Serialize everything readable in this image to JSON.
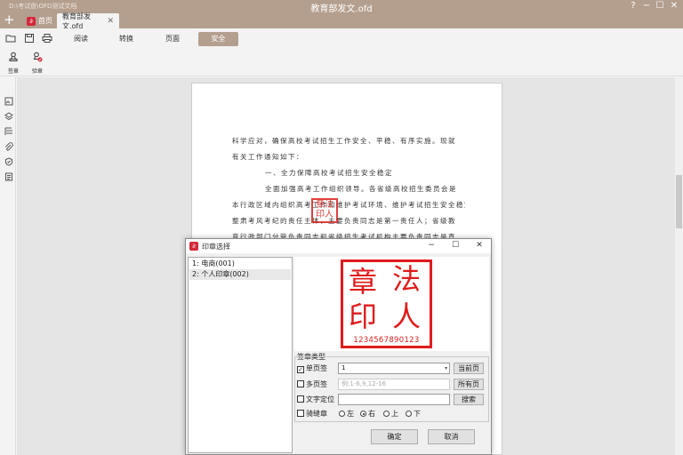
{
  "titlebar": {
    "path": "D:\\考试盘\\OFD测试文档",
    "title": "教育部发文.ofd",
    "help": "?",
    "minimize": "−",
    "maximize": "☐",
    "close": "✕"
  },
  "tabs": {
    "add": "+",
    "home_label": "首页",
    "doc_label": "教育部发文.ofd",
    "doc_close": "✕"
  },
  "toolbar": {
    "menus": [
      "阅读",
      "转换",
      "页面",
      "安全"
    ],
    "active_menu": "安全",
    "security_tools": [
      {
        "label": "签章",
        "icon": "sign-stamp-icon"
      },
      {
        "label": "验章",
        "icon": "verify-stamp-icon"
      }
    ]
  },
  "leftbar": {
    "icons": [
      "thumbnail-icon",
      "layers-icon",
      "outline-icon",
      "attachment-icon",
      "signature-panel-icon",
      "annotation-list-icon"
    ]
  },
  "document": {
    "lines": [
      "科学应对，确保高校考试招生工作安全、平稳、有序实施。现就",
      "有关工作通知如下：",
      "一、全力保障高校考试招生安全稳定",
      "全面加强高考工作组织领导。各省级高校招生委员会是",
      "本行政区域内组织高考工作和维护考试环境、维护考试招生安全稳定、",
      "整肃考风考纪的责任主体，主要负责同志是第一责任人；省级教",
      "育行政部门分管负责同志和省级招生考试机构主要负责同志是直"
    ],
    "stamp_chars": "章法印人"
  },
  "dialog": {
    "title": "印章选择",
    "seals": [
      "1: 电商(001)",
      "2: 个人印章(002)"
    ],
    "selected_seal_index": 1,
    "preview": {
      "chars": [
        "章",
        "法",
        "印",
        "人"
      ],
      "number": "1234567890123",
      "color": "#e01b1b"
    },
    "group_label": "签章类型",
    "single_page": {
      "label": "单页签",
      "checked": true,
      "value": "1",
      "button": "当前页"
    },
    "multi_page": {
      "label": "多页签",
      "checked": false,
      "placeholder": "例:1-6,9,12-16",
      "button": "所有页"
    },
    "text_locate": {
      "label": "文字定位",
      "checked": false,
      "value": "",
      "button": "搜索"
    },
    "riding_seal": {
      "label": "骑缝章",
      "checked": false,
      "options": [
        "左",
        "右",
        "上",
        "下"
      ],
      "selected": "右"
    },
    "ok": "确定",
    "cancel": "取消"
  },
  "colors": {
    "accent": "#b49f8f",
    "stamp_red": "#e01b1b",
    "logo_red": "#d3283b"
  }
}
